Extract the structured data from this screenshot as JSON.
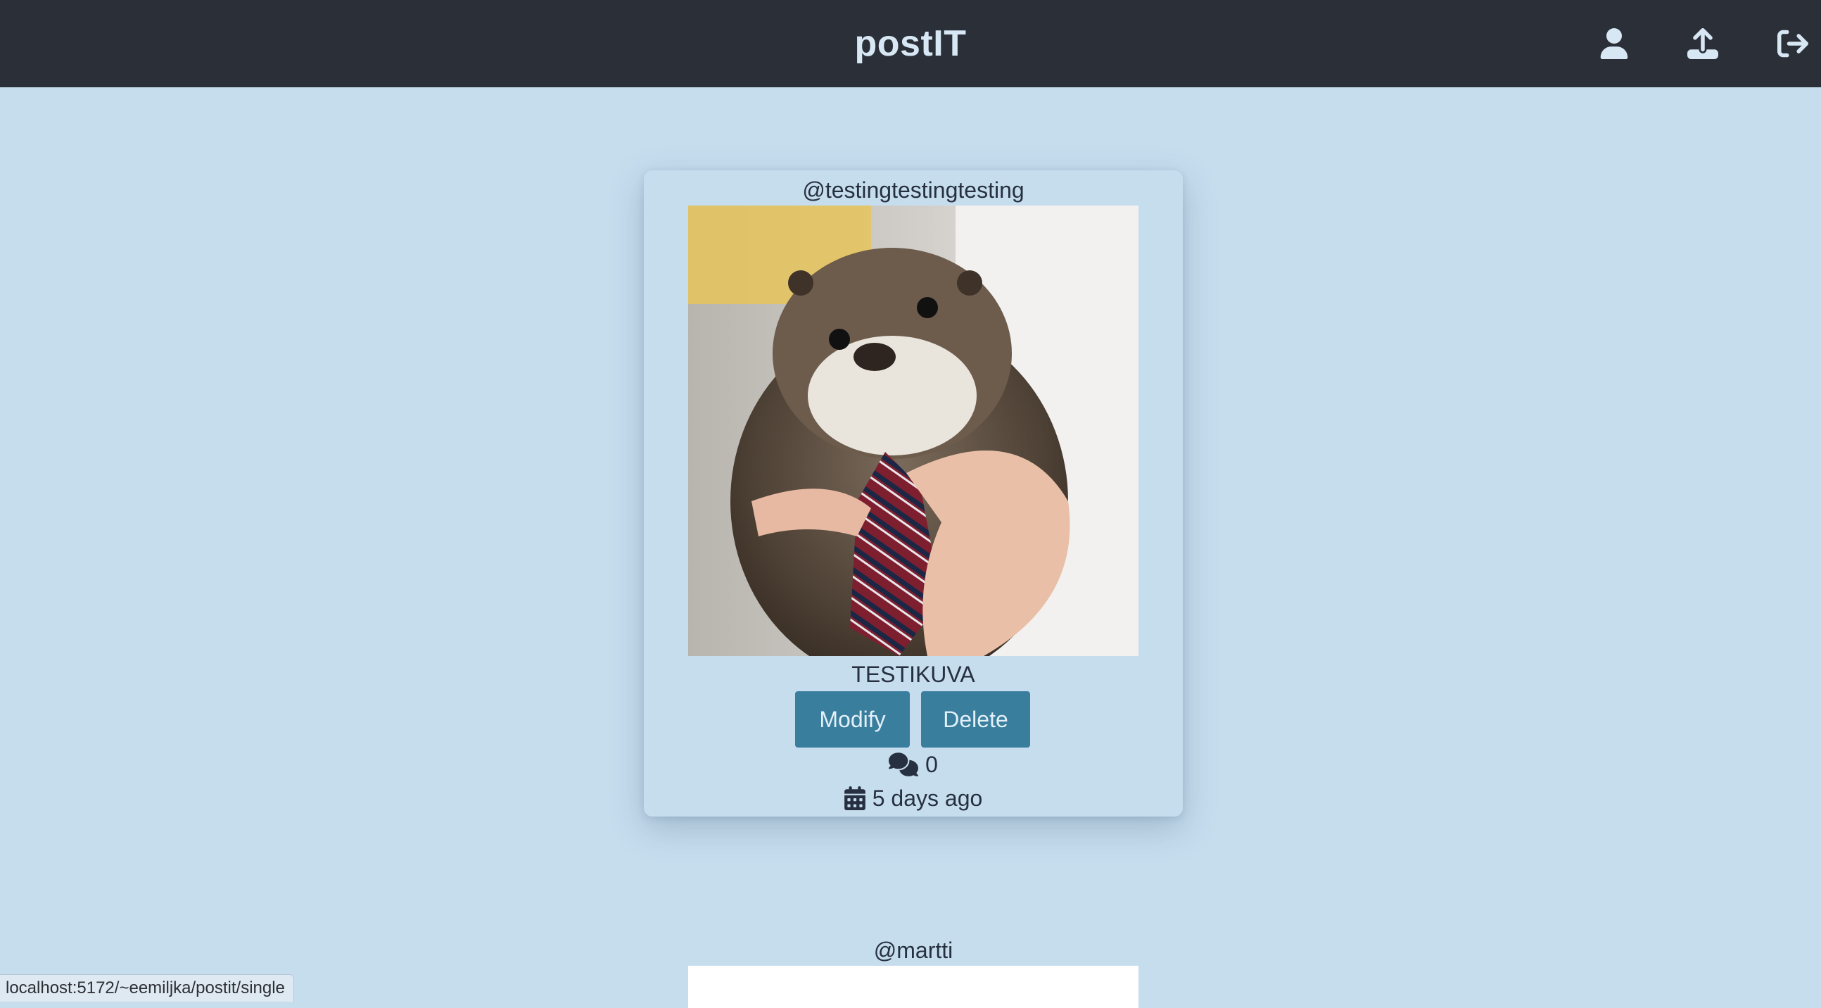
{
  "app": {
    "title": "postIT"
  },
  "header": {
    "icons": [
      "user-icon",
      "upload-icon",
      "logout-icon"
    ]
  },
  "post": {
    "username": "@testingtestingtesting",
    "image_alt": "Otter wearing a striped tie",
    "title": "TESTIKUVA",
    "modify_label": "Modify",
    "delete_label": "Delete",
    "comment_count": "0",
    "date_text": "5 days ago"
  },
  "next_post": {
    "username": "@martti"
  },
  "status_bar": {
    "url": "localhost:5172/~eemiljka/postit/single"
  },
  "colors": {
    "header_bg": "#2b2f38",
    "page_bg": "#c6ddee",
    "button_bg": "#3a7e9e"
  }
}
